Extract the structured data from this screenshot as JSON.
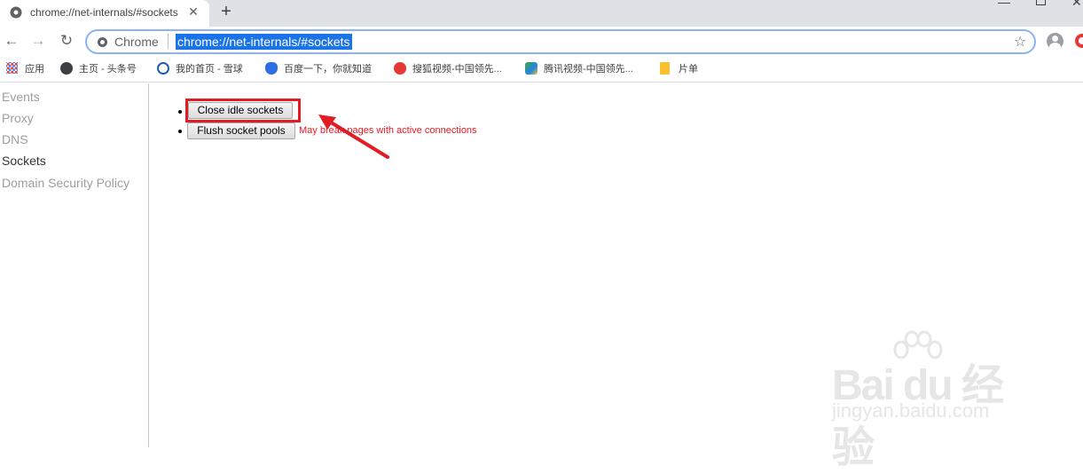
{
  "tab": {
    "title": "chrome://net-internals/#sockets"
  },
  "omnibox": {
    "site_label": "Chrome",
    "url": "chrome://net-internals/#sockets"
  },
  "bookmarks": [
    {
      "label": "应用"
    },
    {
      "label": "主页 - 头条号"
    },
    {
      "label": "我的首页 - 雪球"
    },
    {
      "label": "百度一下，你就知道"
    },
    {
      "label": "搜狐视频-中国领先..."
    },
    {
      "label": "腾讯视频-中国领先..."
    },
    {
      "label": "片单"
    }
  ],
  "sidebar": {
    "items": [
      {
        "label": "Events"
      },
      {
        "label": "Proxy"
      },
      {
        "label": "DNS"
      },
      {
        "label": "Sockets"
      },
      {
        "label": "Domain Security Policy"
      }
    ]
  },
  "main": {
    "close_idle_label": "Close idle sockets",
    "flush_pools_label": "Flush socket pools",
    "warning": "May break pages with active connections"
  },
  "watermark": {
    "brand": "Bai du 经验",
    "url": "jingyan.baidu.com"
  },
  "colors": {
    "accent": "#1a73e8",
    "highlight": "#e31b23"
  }
}
